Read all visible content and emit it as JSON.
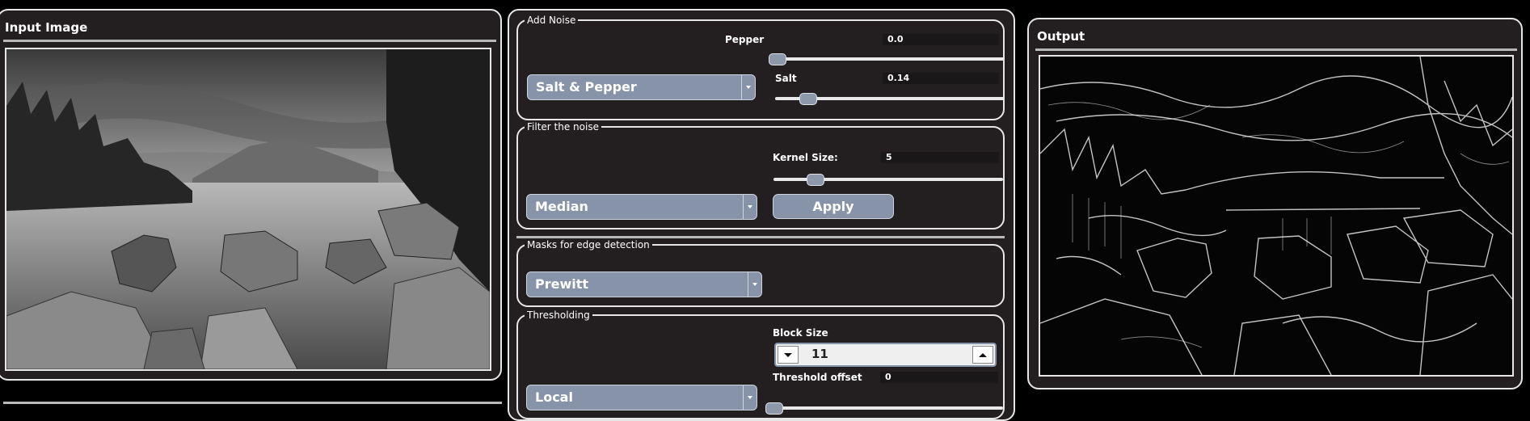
{
  "input_panel": {
    "title": "Input Image"
  },
  "controls": {
    "add_noise": {
      "legend": "Add Noise",
      "type_selected": "Salt & Pepper",
      "pepper": {
        "label": "Pepper",
        "value": "0.0",
        "fraction": 0.0
      },
      "salt": {
        "label": "Salt",
        "value": "0.14",
        "fraction": 0.14
      }
    },
    "filter": {
      "legend": "Filter the noise",
      "type_selected": "Median",
      "kernel": {
        "label": "Kernel Size:",
        "value": "5",
        "fraction": 0.18
      },
      "apply_label": "Apply"
    },
    "edges": {
      "legend": "Masks for edge detection",
      "mask_selected": "Prewitt"
    },
    "threshold": {
      "legend": "Thresholding",
      "type_selected": "Local",
      "block_size": {
        "label": "Block Size",
        "value": "11"
      },
      "offset": {
        "label": "Threshold offset",
        "value": "0",
        "fraction": 0.0
      }
    }
  },
  "output_panel": {
    "title": "Output"
  },
  "icons": {
    "dropdown": "chevron-down-icon",
    "spin_down": "triangle-down-icon",
    "spin_up": "triangle-up-icon"
  }
}
